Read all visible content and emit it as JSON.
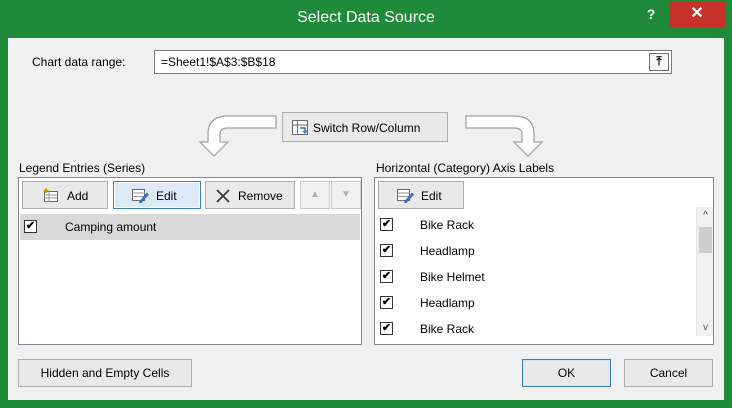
{
  "window": {
    "title": "Select Data Source",
    "help_label": "?",
    "close_label": "✕"
  },
  "range": {
    "label": "Chart data range:",
    "value": "=Sheet1!$A$3:$B$18",
    "collapse_label": "⤒"
  },
  "switch": {
    "label": "Switch Row/Column"
  },
  "legend": {
    "heading": "Legend Entries (Series)",
    "add_label": "Add",
    "edit_label": "Edit",
    "remove_label": "Remove",
    "up_label": "▲",
    "down_label": "▼",
    "series": [
      {
        "name": "Camping amount",
        "checked": true
      }
    ]
  },
  "axis": {
    "heading": "Horizontal (Category) Axis Labels",
    "edit_label": "Edit",
    "items": [
      {
        "label": "Bike Rack",
        "checked": true
      },
      {
        "label": "Headlamp",
        "checked": true
      },
      {
        "label": "Bike Helmet",
        "checked": true
      },
      {
        "label": "Headlamp",
        "checked": true
      },
      {
        "label": "Bike Rack",
        "checked": true
      }
    ],
    "scroll_up": "^",
    "scroll_down": "v"
  },
  "footer": {
    "hidden_cells_label": "Hidden and Empty Cells",
    "ok_label": "OK",
    "cancel_label": "Cancel"
  },
  "check_mark": "✔",
  "colors": {
    "titlebar": "#1f8a3a",
    "close": "#c7302b",
    "selected_row": "#d9d9d9"
  }
}
